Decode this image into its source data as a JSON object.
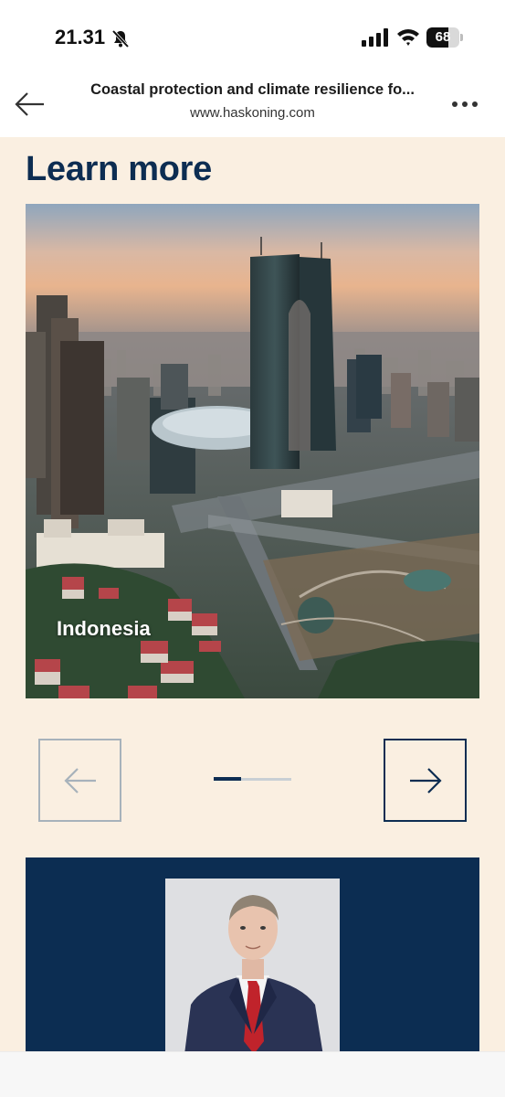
{
  "status_bar": {
    "time": "21.31",
    "battery_level": 68,
    "battery_label": "68"
  },
  "browser": {
    "title": "Coastal protection and climate resilience fo...",
    "url": "www.haskoning.com",
    "back_icon": "arrow-left-icon",
    "more_icon": "ellipsis-icon"
  },
  "learn_more": {
    "heading": "Learn more",
    "carousel": {
      "current_card_label": "Indonesia",
      "position": 1,
      "progress_fraction": 0.35,
      "prev_icon": "arrow-left-icon",
      "next_icon": "arrow-right-icon"
    }
  },
  "colors": {
    "page_background": "#faefe1",
    "brand_navy": "#0d2d52",
    "disabled_border": "#a7b2bb"
  }
}
